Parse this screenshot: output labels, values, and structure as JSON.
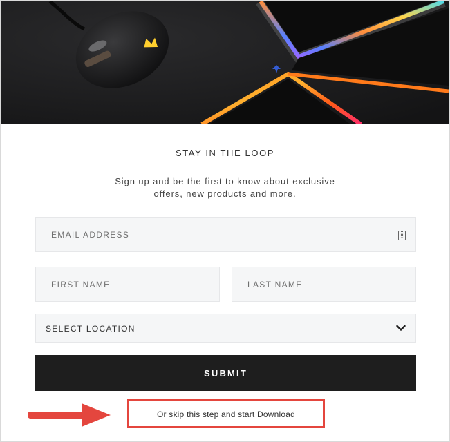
{
  "hero": {
    "image": "corsair-mouse-on-rgb-mousepad",
    "accent_colors": [
      "#ff7a1a",
      "#ffcf2e",
      "#2fd3e6",
      "#3a6bff",
      "#b43cff"
    ]
  },
  "modal": {
    "title": "STAY IN THE LOOP",
    "subtitle_line1": "Sign up and be the first to know about exclusive",
    "subtitle_line2": "offers, new products and more."
  },
  "form": {
    "email_placeholder": "EMAIL ADDRESS",
    "email_icon": "contact-card-icon",
    "first_name_placeholder": "FIRST NAME",
    "last_name_placeholder": "LAST NAME",
    "location_selected": "SELECT LOCATION",
    "location_icon": "chevron-down-icon",
    "submit_label": "SUBMIT"
  },
  "skip": {
    "label": "Or skip this step and start Download",
    "highlight_color": "#e4463e",
    "arrow_icon": "right-arrow-icon"
  }
}
